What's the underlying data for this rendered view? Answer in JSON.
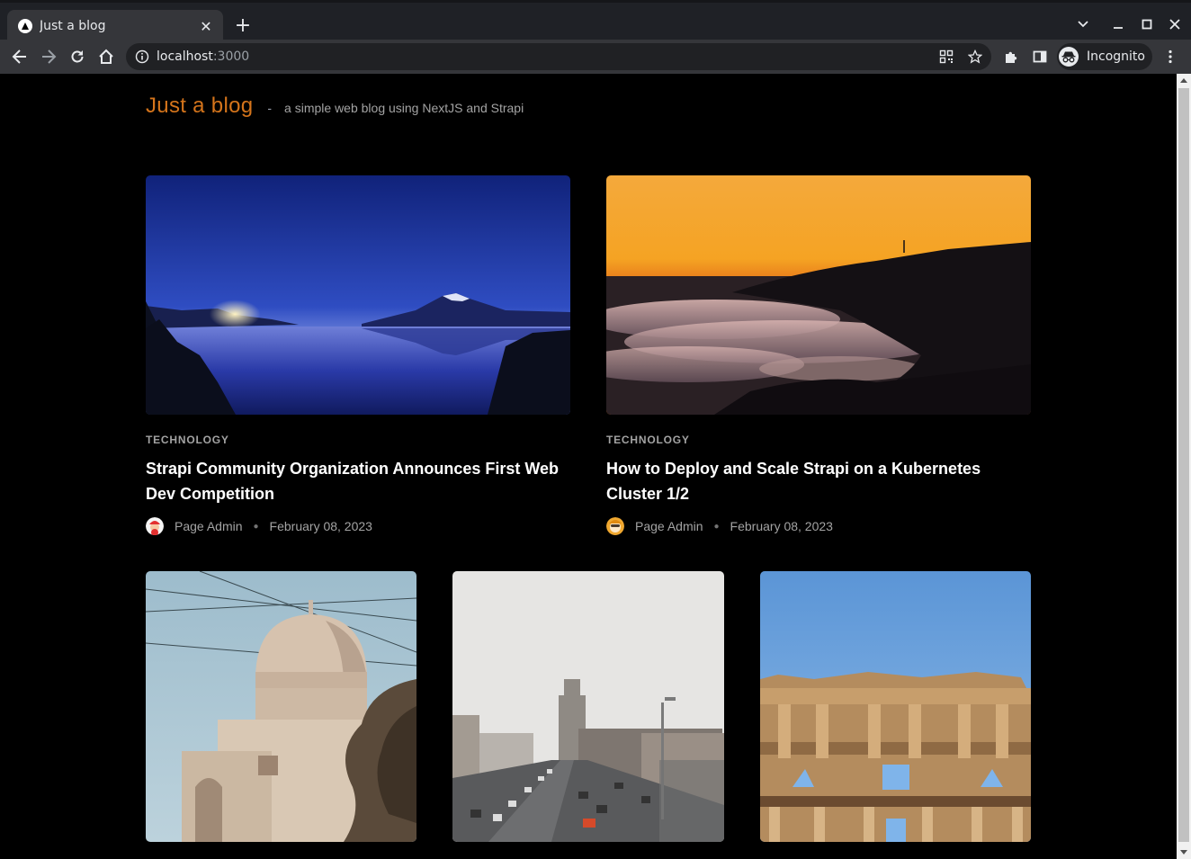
{
  "browser": {
    "tab_title": "Just a blog",
    "url_host": "localhost",
    "url_port": ":3000",
    "profile_label": "Incognito"
  },
  "site": {
    "title": "Just a blog",
    "separator": "-",
    "tagline": "a simple web blog using NextJS and Strapi"
  },
  "featured_posts": [
    {
      "category": "TECHNOLOGY",
      "title": "Strapi Community Organization Announces First Web Dev Competition",
      "author": "Page Admin",
      "date": "February 08, 2023",
      "image": "mount-fuji-lake-night"
    },
    {
      "category": "TECHNOLOGY",
      "title": "How to Deploy and Scale Strapi on a Kubernetes Cluster 1/2",
      "author": "Page Admin",
      "date": "February 08, 2023",
      "image": "sunset-sea-of-clouds"
    }
  ],
  "posts": [
    {
      "image": "domed-mausoleum"
    },
    {
      "image": "city-highway-traffic"
    },
    {
      "image": "library-of-celsus-ruins"
    }
  ],
  "colors": {
    "accent": "#d4741b",
    "background": "#000000"
  }
}
